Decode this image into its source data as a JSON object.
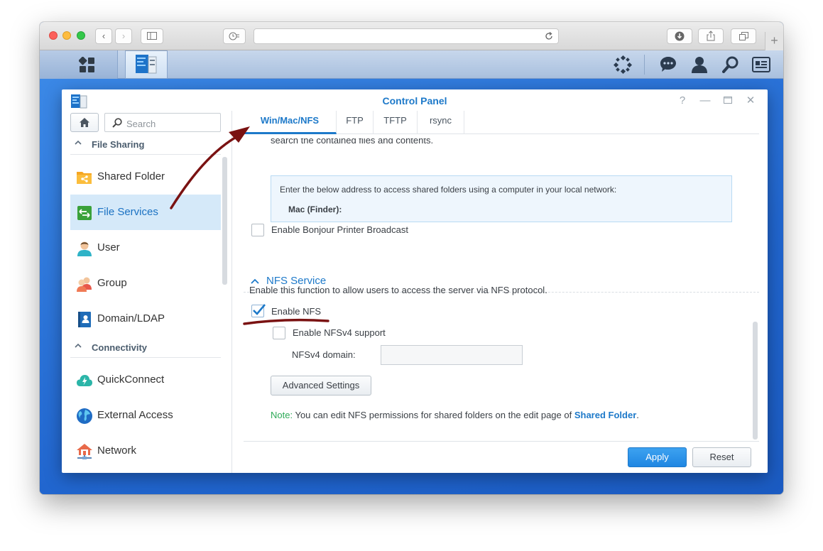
{
  "browser": {
    "buttons": [
      "back",
      "forward",
      "sidebar",
      "history",
      "reload",
      "downloads",
      "share",
      "tabs",
      "new-tab"
    ]
  },
  "control_panel": {
    "title": "Control Panel",
    "search_placeholder": "Search",
    "sections": [
      {
        "label": "File Sharing",
        "items": [
          "Shared Folder",
          "File Services",
          "User",
          "Group",
          "Domain/LDAP"
        ]
      },
      {
        "label": "Connectivity",
        "items": [
          "QuickConnect",
          "External Access",
          "Network"
        ]
      }
    ],
    "active_item": "File Services"
  },
  "tabs": [
    "Win/Mac/NFS",
    "FTP",
    "TFTP",
    "rsync"
  ],
  "content": {
    "cut_text": "search the contained files and contents.",
    "info_text": "Enter the below address to access shared folders using a computer in your local network:",
    "mac_label": "Mac (Finder):",
    "bonjour_label": "Enable Bonjour Printer Broadcast",
    "nfs_section_title": "NFS Service",
    "nfs_description": "Enable this function to allow users to access the server via NFS protocol.",
    "enable_nfs_label": "Enable NFS",
    "enable_nfs_checked": true,
    "nfsv4_label": "Enable NFSv4 support",
    "nfsv4_checked": false,
    "nfsv4_domain_label": "NFSv4 domain:",
    "nfsv4_domain_value": "",
    "advanced_button": "Advanced Settings",
    "note_label": "Note:",
    "note_text": "You can edit NFS permissions for shared folders on the edit page of",
    "note_link": "Shared Folder",
    "note_end": "."
  },
  "footer": {
    "apply": "Apply",
    "reset": "Reset"
  },
  "colors": {
    "accent": "#1d79c9",
    "annotation": "#7a1212",
    "note_green": "#2eaa58"
  }
}
